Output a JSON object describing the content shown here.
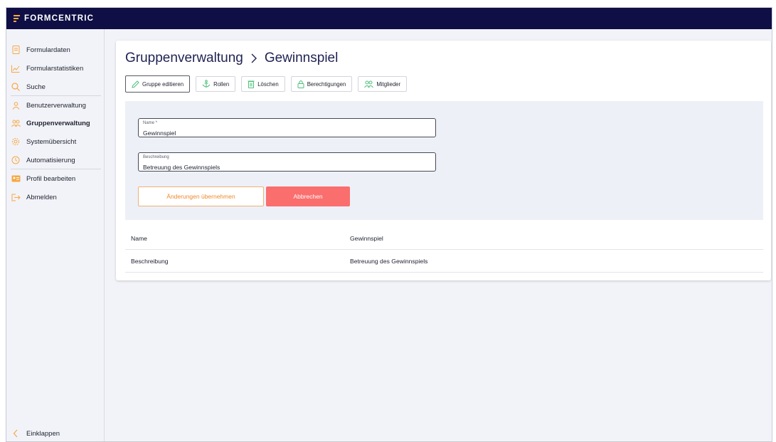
{
  "app": {
    "brand": "FORMCENTRIC"
  },
  "sidebar": {
    "items": [
      {
        "label": "Formulardaten",
        "icon": "document-icon"
      },
      {
        "label": "Formularstatistiken",
        "icon": "line-chart-icon"
      },
      {
        "label": "Suche",
        "icon": "search-icon"
      },
      {
        "label": "Benutzerverwaltung",
        "icon": "user-icon"
      },
      {
        "label": "Gruppenverwaltung",
        "icon": "users-icon",
        "active": true
      },
      {
        "label": "Systemübersicht",
        "icon": "gear-icon"
      },
      {
        "label": "Automatisierung",
        "icon": "clock-icon"
      },
      {
        "label": "Profil bearbeiten",
        "icon": "id-card-icon"
      },
      {
        "label": "Abmelden",
        "icon": "logout-icon"
      }
    ],
    "collapse_label": "Einklappen"
  },
  "breadcrumb": {
    "parent": "Gruppenverwaltung",
    "current": "Gewinnspiel"
  },
  "toolbar": {
    "edit": "Gruppe editieren",
    "roles": "Rollen",
    "delete": "Löschen",
    "permissions": "Berechtigungen",
    "members": "Mitglieder"
  },
  "form": {
    "name_label": "Name *",
    "name_value": "Gewinnspiel",
    "desc_label": "Beschreibung",
    "desc_value": "Betreuung des Gewinnspiels",
    "apply": "Änderungen übernehmen",
    "cancel": "Abbrechen"
  },
  "details": [
    {
      "key": "Name",
      "value": "Gewinnspiel"
    },
    {
      "key": "Beschreibung",
      "value": "Betreuung des Gewinnspiels"
    }
  ],
  "colors": {
    "accent": "#f7a744",
    "nav_bg": "#0f0f45",
    "cancel": "#fa6e6e",
    "icon": "#4ec07a"
  }
}
